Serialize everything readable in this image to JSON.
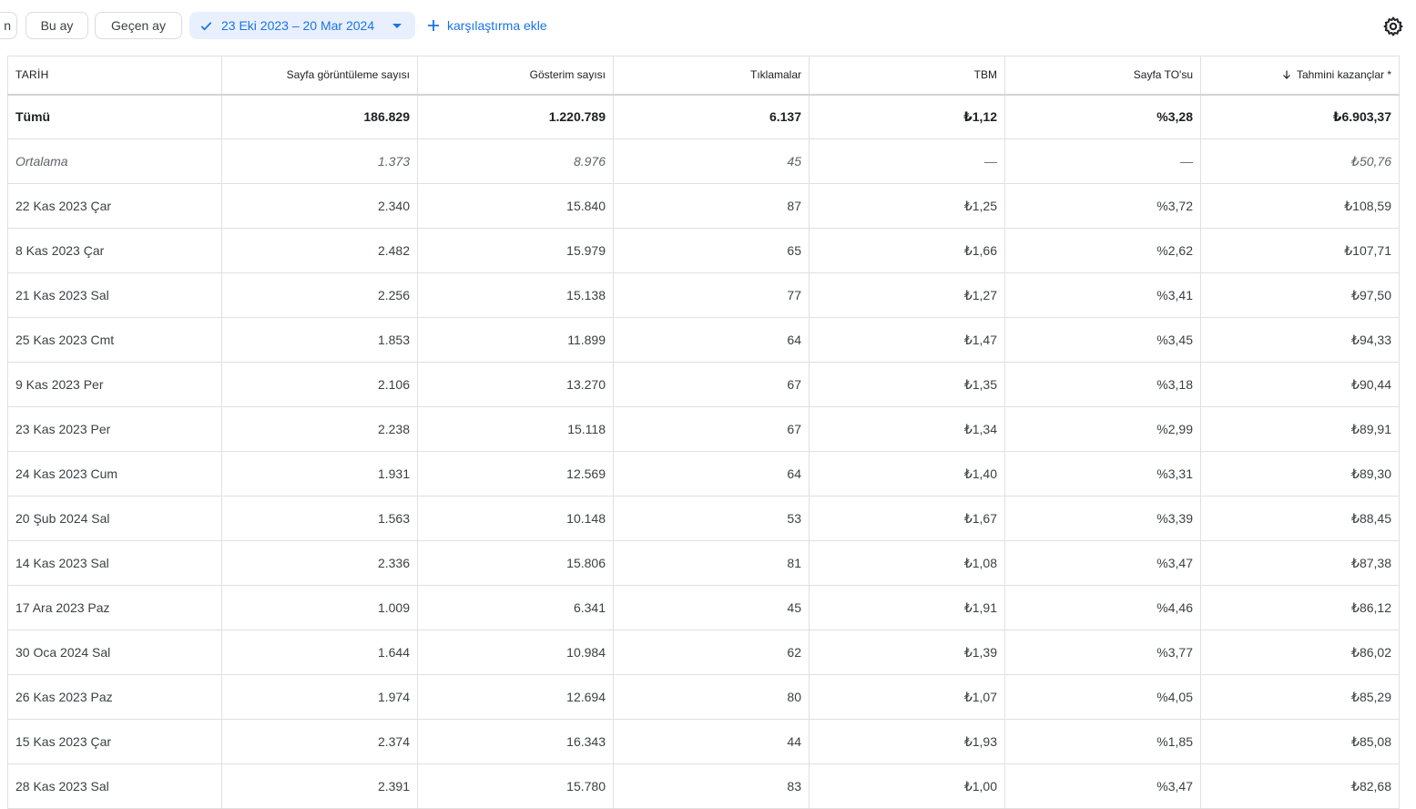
{
  "toolbar": {
    "partial_chip_label": "n",
    "this_month_label": "Bu ay",
    "last_month_label": "Geçen ay",
    "date_range_label": "23 Eki 2023 – 20 Mar 2024",
    "add_comparison_label": "karşılaştırma ekle",
    "accent_color": "#1a73e8"
  },
  "table": {
    "headers": {
      "date": "TARİH",
      "page_views": "Sayfa görüntüleme sayısı",
      "impressions": "Gösterim sayısı",
      "clicks": "Tıklamalar",
      "cpc": "TBM",
      "page_ctr": "Sayfa TO'su",
      "earnings": "Tahmini kazançlar *"
    },
    "sorted_column": "earnings",
    "sort_direction": "descending",
    "rows": [
      {
        "kind": "total",
        "date": "Tümü",
        "page_views": "186.829",
        "impressions": "1.220.789",
        "clicks": "6.137",
        "cpc": "₺1,12",
        "page_ctr": "%3,28",
        "earnings": "₺6.903,37"
      },
      {
        "kind": "average",
        "date": "Ortalama",
        "page_views": "1.373",
        "impressions": "8.976",
        "clicks": "45",
        "cpc": "—",
        "page_ctr": "—",
        "earnings": "₺50,76"
      },
      {
        "kind": "day",
        "date": "22 Kas 2023 Çar",
        "page_views": "2.340",
        "impressions": "15.840",
        "clicks": "87",
        "cpc": "₺1,25",
        "page_ctr": "%3,72",
        "earnings": "₺108,59"
      },
      {
        "kind": "day",
        "date": "8 Kas 2023 Çar",
        "page_views": "2.482",
        "impressions": "15.979",
        "clicks": "65",
        "cpc": "₺1,66",
        "page_ctr": "%2,62",
        "earnings": "₺107,71"
      },
      {
        "kind": "day",
        "date": "21 Kas 2023 Sal",
        "page_views": "2.256",
        "impressions": "15.138",
        "clicks": "77",
        "cpc": "₺1,27",
        "page_ctr": "%3,41",
        "earnings": "₺97,50"
      },
      {
        "kind": "day",
        "date": "25 Kas 2023 Cmt",
        "page_views": "1.853",
        "impressions": "11.899",
        "clicks": "64",
        "cpc": "₺1,47",
        "page_ctr": "%3,45",
        "earnings": "₺94,33"
      },
      {
        "kind": "day",
        "date": "9 Kas 2023 Per",
        "page_views": "2.106",
        "impressions": "13.270",
        "clicks": "67",
        "cpc": "₺1,35",
        "page_ctr": "%3,18",
        "earnings": "₺90,44"
      },
      {
        "kind": "day",
        "date": "23 Kas 2023 Per",
        "page_views": "2.238",
        "impressions": "15.118",
        "clicks": "67",
        "cpc": "₺1,34",
        "page_ctr": "%2,99",
        "earnings": "₺89,91"
      },
      {
        "kind": "day",
        "date": "24 Kas 2023 Cum",
        "page_views": "1.931",
        "impressions": "12.569",
        "clicks": "64",
        "cpc": "₺1,40",
        "page_ctr": "%3,31",
        "earnings": "₺89,30"
      },
      {
        "kind": "day",
        "date": "20 Şub 2024 Sal",
        "page_views": "1.563",
        "impressions": "10.148",
        "clicks": "53",
        "cpc": "₺1,67",
        "page_ctr": "%3,39",
        "earnings": "₺88,45"
      },
      {
        "kind": "day",
        "date": "14 Kas 2023 Sal",
        "page_views": "2.336",
        "impressions": "15.806",
        "clicks": "81",
        "cpc": "₺1,08",
        "page_ctr": "%3,47",
        "earnings": "₺87,38"
      },
      {
        "kind": "day",
        "date": "17 Ara 2023 Paz",
        "page_views": "1.009",
        "impressions": "6.341",
        "clicks": "45",
        "cpc": "₺1,91",
        "page_ctr": "%4,46",
        "earnings": "₺86,12"
      },
      {
        "kind": "day",
        "date": "30 Oca 2024 Sal",
        "page_views": "1.644",
        "impressions": "10.984",
        "clicks": "62",
        "cpc": "₺1,39",
        "page_ctr": "%3,77",
        "earnings": "₺86,02"
      },
      {
        "kind": "day",
        "date": "26 Kas 2023 Paz",
        "page_views": "1.974",
        "impressions": "12.694",
        "clicks": "80",
        "cpc": "₺1,07",
        "page_ctr": "%4,05",
        "earnings": "₺85,29"
      },
      {
        "kind": "day",
        "date": "15 Kas 2023 Çar",
        "page_views": "2.374",
        "impressions": "16.343",
        "clicks": "44",
        "cpc": "₺1,93",
        "page_ctr": "%1,85",
        "earnings": "₺85,08"
      },
      {
        "kind": "day",
        "date": "28 Kas 2023 Sal",
        "page_views": "2.391",
        "impressions": "15.780",
        "clicks": "83",
        "cpc": "₺1,00",
        "page_ctr": "%3,47",
        "earnings": "₺82,68"
      }
    ]
  }
}
